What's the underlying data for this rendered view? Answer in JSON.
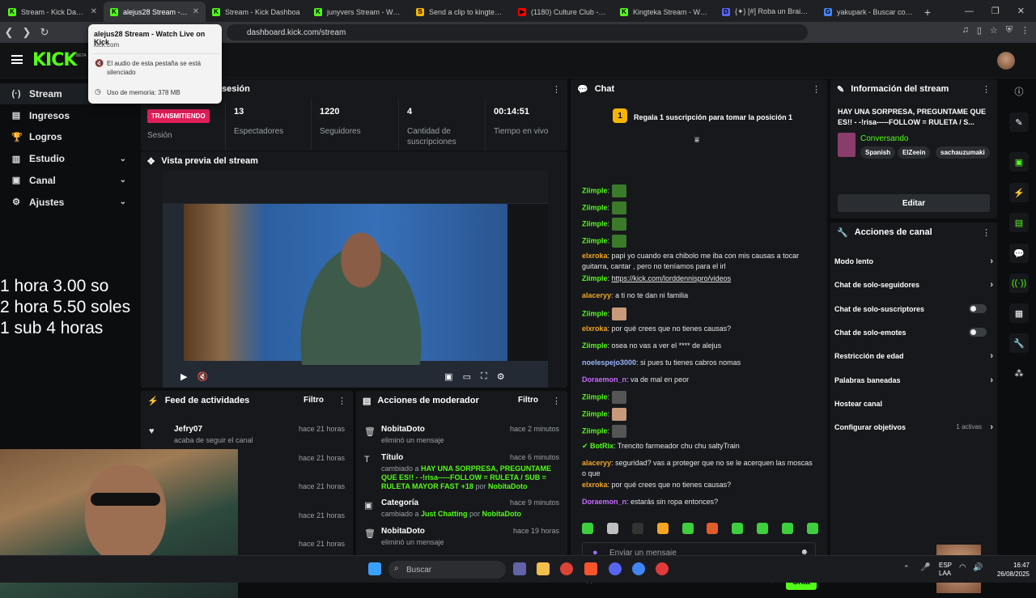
{
  "tabs": [
    {
      "title": "Stream - Kick Dashbo",
      "color": "#53fc18",
      "letter": "K"
    },
    {
      "title": "alejus28 Stream - W",
      "color": "#53fc18",
      "letter": "K",
      "active": true
    },
    {
      "title": "Stream - Kick Dashboa",
      "color": "#53fc18",
      "letter": "K"
    },
    {
      "title": "junyvers Stream - Watch L",
      "color": "#53fc18",
      "letter": "K"
    },
    {
      "title": "Send a clip to kingtekabo",
      "color": "#f5b400",
      "letter": "S"
    },
    {
      "title": "(1180) Culture Club - Karm",
      "color": "#ff0000",
      "letter": "▶"
    },
    {
      "title": "Kingteka Stream - Watch L",
      "color": "#53fc18",
      "letter": "K"
    },
    {
      "title": "{✦} [#] Roba un Brainrot",
      "color": "#5865f2",
      "letter": "D"
    },
    {
      "title": "yakupark - Buscar con Goo",
      "color": "#4285f4",
      "letter": "G"
    }
  ],
  "browser": {
    "url": "dashboard.kick.com/stream"
  },
  "tab_popup": {
    "title": "alejus28 Stream - Watch Live on Kick",
    "domain": "kick.com",
    "muted": "El audio de esta pestaña se está silenciado",
    "memory": "Uso de memoria: 378 MB"
  },
  "brand": {
    "logo": "KICK",
    "beta": "BETA"
  },
  "sidebar": [
    {
      "label": "Stream",
      "icon": "(·)"
    },
    {
      "label": "Ingresos",
      "icon": "▤"
    },
    {
      "label": "Logros",
      "icon": "🏆"
    },
    {
      "label": "Estudio",
      "icon": "▥"
    },
    {
      "label": "Canal",
      "icon": "▣"
    },
    {
      "label": "Ajustes",
      "icon": "⚙"
    }
  ],
  "overlay_text": [
    "1 hora 3.00 so",
    "2 hora 5.50 soles",
    "1 sub 4 horas"
  ],
  "session": {
    "title": "sesión",
    "status": "TRANSMITIENDO",
    "status_label": "Sesión",
    "stats": [
      {
        "value": "13",
        "label": "Espectadores"
      },
      {
        "value": "1220",
        "label": "Seguidores"
      },
      {
        "value": "4",
        "label": "Cantidad de suscripciones"
      },
      {
        "value": "00:14:51",
        "label": "Tiempo en vivo"
      }
    ]
  },
  "preview": {
    "title": "Vista previa del stream"
  },
  "feed": {
    "title": "Feed de actividades",
    "filter": "Filtro",
    "items": [
      {
        "who": "Jefry07",
        "sub": "acaba de seguir el canal",
        "when": "hace 21 horas"
      },
      {
        "who": "",
        "sub": "",
        "when": "hace 21 horas"
      },
      {
        "who": "",
        "sub": "",
        "when": "hace 21 horas"
      },
      {
        "who": "",
        "sub": "",
        "when": "hace 21 horas"
      },
      {
        "who": "",
        "sub": "",
        "when": "hace 21 horas"
      }
    ]
  },
  "mod": {
    "title": "Acciones de moderador",
    "filter": "Filtro",
    "items": [
      {
        "who": "NobitaDoto",
        "sub": "eliminó un mensaje",
        "when": "hace 2 minutos"
      },
      {
        "who": "Título",
        "sub_pre": "cambiado a ",
        "sub_hl": "HAY UNA SORPRESA, PREGUNTAME QUE ES!! - -!risa-----FOLLOW = RULETA / SUB = RULETA MAYOR FAST +18",
        "sub_by": " por ",
        "sub_user": "NobitaDoto",
        "when": "hace 6 minutos"
      },
      {
        "who": "Categoría",
        "sub_pre": "cambiado a ",
        "sub_hl": "Just Chatting",
        "sub_by": " por ",
        "sub_user": "NobitaDoto",
        "when": "hace 9 minutos"
      },
      {
        "who": "NobitaDoto",
        "sub": "eliminó un mensaje",
        "when": "hace 19 horas"
      }
    ]
  },
  "chat": {
    "title": "Chat",
    "pinned": "Regala 1 suscripción para tomar la posición 1",
    "pinned_rank": "1",
    "messages": [
      {
        "user": "Ziimple",
        "color": "#53fc18",
        "text": "",
        "emote": "#3a7a2a"
      },
      {
        "user": "Ziimple",
        "color": "#53fc18",
        "text": "",
        "emote": "#3a7a2a"
      },
      {
        "user": "Ziimple",
        "color": "#53fc18",
        "text": "",
        "emote": "#3a7a2a"
      },
      {
        "user": "Ziimple",
        "color": "#53fc18",
        "text": "",
        "emote": "#3a7a2a"
      },
      {
        "user": "elxroka",
        "color": "#f5a623",
        "text": "papi yo cuando era chibolo me iba con mis causas a tocar guitarra, cantar , pero no teníamos para el irl"
      },
      {
        "user": "Ziimple",
        "color": "#53fc18",
        "text": "https://kick.com/lorddennispro/videos"
      },
      {
        "user": "alaceryy",
        "color": "#f5a623",
        "text": "a ti no te dan ni familia"
      },
      {
        "user": "Ziimple",
        "color": "#53fc18",
        "text": "",
        "emote": "#c89a7a"
      },
      {
        "user": "elxroka",
        "color": "#f5a623",
        "text": "por qué crees que no tienes causas?"
      },
      {
        "user": "Ziimple",
        "color": "#53fc18",
        "text": "osea no vas a ver el **** de alejus"
      },
      {
        "user": "noelespejo3000",
        "color": "#9ab4ff",
        "text": "si pues tu tienes cabros nomas"
      },
      {
        "user": "Doraemon_n",
        "color": "#c86bff",
        "text": "va de mal en peor"
      },
      {
        "user": "Ziimple",
        "color": "#53fc18",
        "text": "",
        "emote": "#555"
      },
      {
        "user": "Ziimple",
        "color": "#53fc18",
        "text": "",
        "emote": "#c89a7a"
      },
      {
        "user": "Ziimple",
        "color": "#53fc18",
        "text": "",
        "emote": "#555"
      },
      {
        "user": "BotRix",
        "color": "#53fc18",
        "text": "Trencito farmeador chu chu saltyTrain",
        "bot": true
      },
      {
        "user": "alaceryy",
        "color": "#f5a623",
        "text": "seguridad? vas a proteger que no se le acerquen las moscas o que"
      },
      {
        "user": "elxroka",
        "color": "#f5a623",
        "text": "por qué crees que no tienes causas?"
      },
      {
        "user": "Doraemon_n",
        "color": "#c86bff",
        "text": "estarás sin ropa entonces?"
      }
    ],
    "input_placeholder": "Enviar un mensaje",
    "send": "Chat"
  },
  "info": {
    "title": "Información del stream",
    "stream_title": "HAY UNA SORPRESA, PREGUNTAME QUE ES!! - -!risa-----FOLLOW = RULETA / S...",
    "category": "Conversando",
    "tags": [
      "Spanish",
      "ElZeein",
      "sachauzumaki"
    ],
    "edit": "Editar"
  },
  "actions": {
    "title": "Acciones de canal",
    "items": [
      {
        "label": "Modo lento",
        "type": "chevron"
      },
      {
        "label": "Chat de solo-seguidores",
        "type": "chevron"
      },
      {
        "label": "Chat de solo-suscriptores",
        "type": "toggle"
      },
      {
        "label": "Chat de solo-emotes",
        "type": "toggle"
      },
      {
        "label": "Restricción de edad",
        "type": "chevron"
      },
      {
        "label": "Palabras baneadas",
        "type": "chevron"
      },
      {
        "label": "Hostear canal",
        "type": "none"
      },
      {
        "label": "Configurar objetivos",
        "type": "chevron",
        "extra": "1 activas"
      }
    ]
  },
  "taskbar": {
    "search": "Buscar",
    "lang1": "ESP",
    "lang2": "LAA",
    "time": "16:47",
    "date": "26/08/2025"
  }
}
